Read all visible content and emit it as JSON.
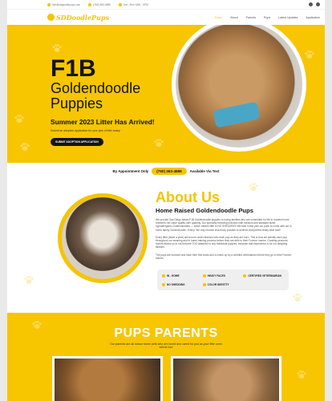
{
  "topbar": {
    "email": "info@sdgoodlepups.com",
    "phone": "(760) 363-4686",
    "hours": "Sat - Mon 9AM - 6PM"
  },
  "nav": {
    "logo_text": "SDDoodlePups",
    "items": [
      "Home",
      "About",
      "Parents",
      "Pups",
      "Latest Updates",
      "Application"
    ]
  },
  "hero": {
    "title_line1": "F1B",
    "title_line2": "Goldendoodle",
    "title_line3": "Puppies",
    "subtitle": "Summer 2023 Litter Has Arrived!",
    "small_text": "Submit an adoption application for your pick of litter today!",
    "cta_label": "SUBMIT ADOPTION APPLICATION"
  },
  "appointment": {
    "before": "By Appointment Only",
    "phone": "(760) 363-4686",
    "after": "Available Via Text"
  },
  "about": {
    "title": "About Us",
    "subtitle": "Home Raised Goldendoodle Pups",
    "para1": "We provide San Diego based F1B Goldendoodle puppies to loving families who are committed for life to modest home breeders; we value quality over quantity. Our specialty breeding includes both medium and standard sized hypoallergenic Goldendoodles — which means little to NO SHEDDING! We take home pick our pups to come with our in home family Goldendoodle, Emmy. We only choose less-fussy poodles to achieve that perfect teddy bear face!",
    "para2": "Every litter (twice a year) we're born under Mama's who each pup as they are born. This is how we identify each pup throughout our weaning and in home training process before they are able to their Forever homes. Curating personal homes allows us to not become TOO attached to any individual puppies, because that experience is for our adopting families.",
    "para3": "The pups are wormed and have their first shots and a check up by a certified veterinarian before they go to their Forever homes.",
    "features": [
      "IN - HOME",
      "HEAVY FACES",
      "CERTIFIED VETERINARIAN",
      "NO SHEDDING",
      "COLOR IDENTITY"
    ]
  },
  "parents": {
    "title": "PUPS PARENTS",
    "text": "Our parents are all indoor home pets who are loved and cared for just as your little ones will be too!"
  },
  "colors": {
    "accent": "#f7c600",
    "dark": "#141414"
  }
}
